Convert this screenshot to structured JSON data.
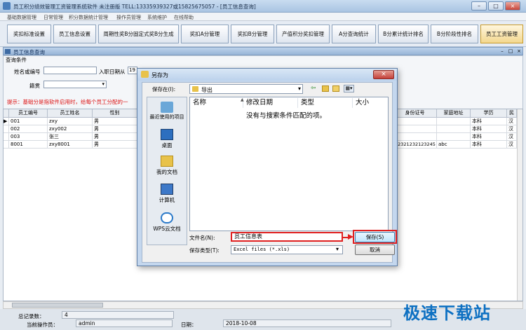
{
  "app": {
    "title": "员工积分绩效管理工资管理系统软件 未注册版 TELL:13335939327或15825675057 - [员工信息查询]",
    "menu": [
      "基础数据管理",
      "日常管理",
      "积分数据统计管理",
      "操作员管理",
      "系统维护",
      "在线帮助"
    ],
    "window_controls": [
      "–",
      "□",
      "×"
    ],
    "mdi_controls": [
      "–",
      "□",
      "×"
    ]
  },
  "toolbar": {
    "buttons": [
      "奖扣标准设置",
      "员工信息设置",
      "周期性奖B分固定式奖B分生成",
      "奖扣A分管理",
      "奖扣B分管理",
      "产值积分奖扣管理",
      "A分查询统计",
      "B分累计统计排名",
      "B分阶段性排名",
      "员工工资管理"
    ]
  },
  "subwindow": {
    "title": "员工信息查询",
    "query_group": "查询条件",
    "name_label": "姓名或编号",
    "name_value": "",
    "join_date_label": "入职日期从",
    "join_date_value": "19",
    "native_label": "籍贯",
    "native_value": "",
    "hint": "提示：基础分是指软件启用时，给每个员工分配的一"
  },
  "grid": {
    "left_columns": [
      "员工编号",
      "员工姓名",
      "性别"
    ],
    "right_columns": [
      "身份证号",
      "家庭地址",
      "学历",
      "民"
    ],
    "rows": [
      {
        "marker": "▶",
        "id": "001",
        "name": "zxy",
        "sex": "男",
        "idcard": "",
        "addr": "",
        "edu": "本科",
        "eth": "汉"
      },
      {
        "marker": "",
        "id": "002",
        "name": "zxy002",
        "sex": "男",
        "idcard": "",
        "addr": "",
        "edu": "本科",
        "eth": "汉"
      },
      {
        "marker": "",
        "id": "003",
        "name": "张三",
        "sex": "男",
        "idcard": "",
        "addr": "",
        "edu": "本科",
        "eth": "汉"
      },
      {
        "marker": "",
        "id": "8001",
        "name": "zxy8001",
        "sex": "男",
        "idcard": "12321232123245",
        "addr": "abc",
        "edu": "本科",
        "eth": "汉"
      }
    ]
  },
  "status": {
    "total_label": "总记录数：",
    "total_value": "4",
    "operator_label": "当前操作员：",
    "operator_value": "admin",
    "date_label": "日期：",
    "date_value": "2018-10-08"
  },
  "dialog": {
    "title": "另存为",
    "save_in_label": "保存在(I):",
    "save_in_value": "导出",
    "places": [
      "最近使用的项目",
      "桌面",
      "我的文档",
      "计算机",
      "WPS云文档"
    ],
    "columns": [
      "名称",
      "修改日期",
      "类型",
      "大小"
    ],
    "empty_text": "没有与搜索条件匹配的项。",
    "filename_label": "文件名(N):",
    "filename_value": "员工信息表",
    "filetype_label": "保存类型(T):",
    "filetype_value": "Excel files (*.xls)",
    "save_button": "保存(S)",
    "cancel_button": "取消"
  },
  "watermark": "极速下载站",
  "colors": {
    "accent_red": "#e02020",
    "hint_red": "#dd1111",
    "watermark_blue": "#0d70c2"
  }
}
